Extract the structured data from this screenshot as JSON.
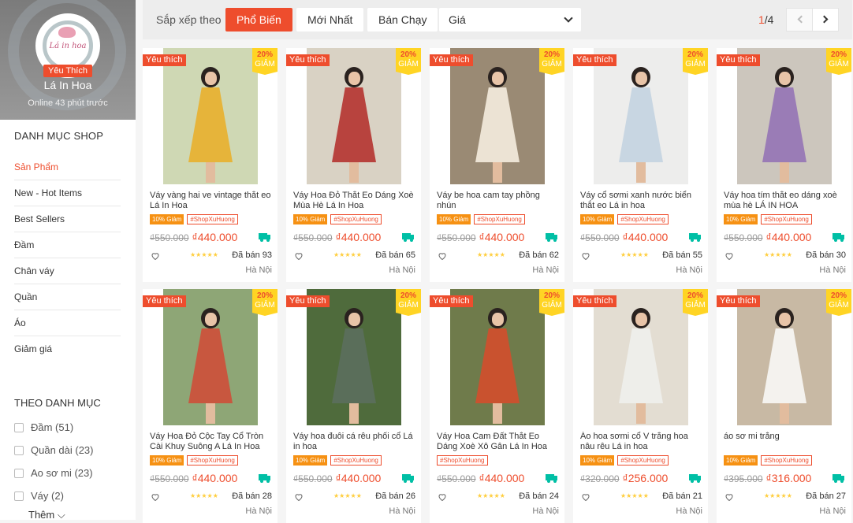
{
  "shop": {
    "logo_text": "Lá in hoa",
    "favorite_label": "Yêu Thích",
    "name": "Lá In Hoa",
    "online_status": "Online 43 phút trước"
  },
  "sidebar": {
    "category_title": "DANH MỤC SHOP",
    "categories": [
      "Sản Phẩm",
      "New - Hot Items",
      "Best Sellers",
      "Đầm",
      "Chân váy",
      "Quần",
      "Áo",
      "Giảm giá"
    ],
    "filter_title": "THEO DANH MỤC",
    "filters": [
      "Đầm (51)",
      "Quần dài (23)",
      "Ao sơ mi (23)",
      "Váy (2)"
    ],
    "more_label": "Thêm ⌵"
  },
  "sortbar": {
    "label": "Sắp xếp theo",
    "options": [
      "Phổ Biến",
      "Mới Nhất",
      "Bán Chạy"
    ],
    "price_label": "Giá",
    "page_current": "1",
    "page_total": "/4"
  },
  "colors": {
    "accent": "#ee4d2d",
    "discount_yellow": "#ffd424",
    "tag_orange": "#f69113",
    "free_ship": "#00bfa5"
  },
  "badges": {
    "favorite": "Yêu thích",
    "discount_pct": "20%",
    "discount_label": "GIẢM",
    "free": "Free"
  },
  "products": [
    {
      "name": "Váy vàng hai ve vintage thắt eo Lá In Hoa",
      "tag_discount": "10% Giảm",
      "tag_shop": "#ShopXuHuong",
      "old_price": "₫550.000",
      "price": "₫440.000",
      "sold": "Đã bán 93",
      "location": "Hà Nội",
      "dress_color": "#e6b43a",
      "bg": "#cfd8b4"
    },
    {
      "name": "Váy Hoa Đỏ Thắt Eo Dáng Xoè Mùa Hè Lá In Hoa",
      "tag_discount": "10% Giảm",
      "tag_shop": "#ShopXuHuong",
      "old_price": "₫550.000",
      "price": "₫440.000",
      "sold": "Đã bán 65",
      "location": "Hà Nội",
      "dress_color": "#b8433e",
      "bg": "#d9d2c4"
    },
    {
      "name": "Váy be hoa cam tay phồng nhún",
      "tag_discount": "10% Giảm",
      "tag_shop": "#ShopXuHuong",
      "old_price": "₫550.000",
      "price": "₫440.000",
      "sold": "Đã bán 62",
      "location": "Hà Nội",
      "dress_color": "#ece3d4",
      "bg": "#9a8a74"
    },
    {
      "name": "Váy cổ sơmi xanh nước biển thắt eo Lá in hoa",
      "tag_discount": "10% Giảm",
      "tag_shop": "#ShopXuHuong",
      "old_price": "₫550.000",
      "price": "₫440.000",
      "sold": "Đã bán 55",
      "location": "Hà Nội",
      "dress_color": "#c8d6e2",
      "bg": "#ededec"
    },
    {
      "name": "Váy hoa tím thắt eo dáng xoè mùa hè LÁ IN HOA",
      "tag_discount": "10% Giảm",
      "tag_shop": "#ShopXuHuong",
      "old_price": "₫550.000",
      "price": "₫440.000",
      "sold": "Đã bán 30",
      "location": "Hà Nội",
      "dress_color": "#9a7cb6",
      "bg": "#ccc6bd"
    },
    {
      "name": "Váy Hoa Đỏ Cộc Tay Cổ Tròn Cài Khuy Suông A Lá In Hoa",
      "tag_discount": "10% Giảm",
      "tag_shop": "#ShopXuHuong",
      "old_price": "₫550.000",
      "price": "₫440.000",
      "sold": "Đã bán 28",
      "location": "Hà Nội",
      "dress_color": "#c8573f",
      "bg": "#8ea676"
    },
    {
      "name": "Váy hoa đuôi cá rêu phối cổ Lá in hoa",
      "tag_discount": "10% Giảm",
      "tag_shop": "#ShopXuHuong",
      "old_price": "₫550.000",
      "price": "₫440.000",
      "sold": "Đã bán 26",
      "location": "Hà Nội",
      "dress_color": "#5a6e5a",
      "bg": "#4f6b3c"
    },
    {
      "name": "Váy Hoa Cam Đất Thắt Eo Dáng Xoè Xô Gân Lá In Hoa",
      "tag_discount": "",
      "tag_shop": "#ShopXuHuong",
      "old_price": "₫550.000",
      "price": "₫440.000",
      "sold": "Đã bán 24",
      "location": "Hà Nội",
      "dress_color": "#c9522f",
      "bg": "#6f7b4b"
    },
    {
      "name": "Áo hoa sơmi cổ V trắng hoa nâu rêu Lá in hoa",
      "tag_discount": "10% Giảm",
      "tag_shop": "#ShopXuHuong",
      "old_price": "₫320.000",
      "price": "₫256.000",
      "sold": "Đã bán 21",
      "location": "Hà Nội",
      "dress_color": "#eeeeea",
      "bg": "#e3ddd2"
    },
    {
      "name": "áo sơ mi trắng",
      "tag_discount": "10% Giảm",
      "tag_shop": "#ShopXuHuong",
      "old_price": "₫395.000",
      "price": "₫316.000",
      "sold": "Đã bán 27",
      "location": "Hà Nội",
      "dress_color": "#f4f2ee",
      "bg": "#c8b9a4"
    }
  ]
}
